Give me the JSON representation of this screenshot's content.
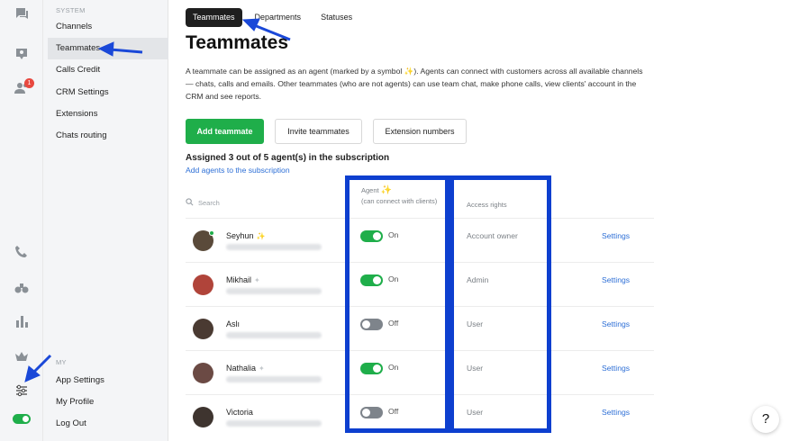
{
  "rail": {
    "badge_count": "1",
    "icons": [
      "chat-icon",
      "inbox-icon",
      "users-icon",
      "phone-icon",
      "binoculars-icon",
      "bar-chart-icon",
      "crown-icon",
      "sliders-icon",
      "status-toggle"
    ]
  },
  "menu": {
    "system_label": "SYSTEM",
    "items": [
      {
        "label": "Channels"
      },
      {
        "label": "Teammates"
      },
      {
        "label": "Calls Credit"
      },
      {
        "label": "CRM Settings"
      },
      {
        "label": "Extensions"
      },
      {
        "label": "Chats routing"
      }
    ],
    "my_label": "MY",
    "my_items": [
      {
        "label": "App Settings"
      },
      {
        "label": "My Profile"
      },
      {
        "label": "Log Out"
      }
    ]
  },
  "tabs": [
    {
      "label": "Teammates",
      "active": true
    },
    {
      "label": "Departments",
      "active": false
    },
    {
      "label": "Statuses",
      "active": false
    }
  ],
  "page_title": "Teammates",
  "description": "A teammate can be assigned as an agent (marked by a symbol ✨). Agents can connect with customers across all available channels — chats, calls and emails. Other teammates (who are not agents) can use team chat, make phone calls, view clients' account in the CRM and see reports.",
  "buttons": {
    "add": "Add teammate",
    "invite": "Invite teammates",
    "extensions": "Extension numbers"
  },
  "assigned_text": "Assigned 3 out of 5 agent(s) in the subscription",
  "add_agents_link": "Add agents to the subscription",
  "table": {
    "search_placeholder": "Search",
    "agent_header": "Agent",
    "agent_subheader": "(can connect with clients)",
    "access_header": "Access rights",
    "rows": [
      {
        "name": "Seyhun",
        "agent": true,
        "agent_mark": "active",
        "toggle_label": "On",
        "access": "Account owner",
        "settings": "Settings",
        "online": true,
        "avatar_color": "#5a4a3a"
      },
      {
        "name": "Mikhail",
        "agent": true,
        "agent_mark": "faded",
        "toggle_label": "On",
        "access": "Admin",
        "settings": "Settings",
        "online": false,
        "avatar_color": "#b0443a"
      },
      {
        "name": "Aslı",
        "agent": false,
        "agent_mark": "none",
        "toggle_label": "Off",
        "access": "User",
        "settings": "Settings",
        "online": false,
        "avatar_color": "#4a3a32"
      },
      {
        "name": "Nathalia",
        "agent": true,
        "agent_mark": "faded",
        "toggle_label": "On",
        "access": "User",
        "settings": "Settings",
        "online": false,
        "avatar_color": "#6b4a44"
      },
      {
        "name": "Victoria",
        "agent": false,
        "agent_mark": "none",
        "toggle_label": "Off",
        "access": "User",
        "settings": "Settings",
        "online": false,
        "avatar_color": "#3e342f"
      }
    ]
  },
  "help_label": "?",
  "colors": {
    "accent_green": "#1fae4a",
    "link_blue": "#2d6fd6",
    "annotation_blue": "#0d3fcf",
    "sparkle": "#f5b400"
  }
}
